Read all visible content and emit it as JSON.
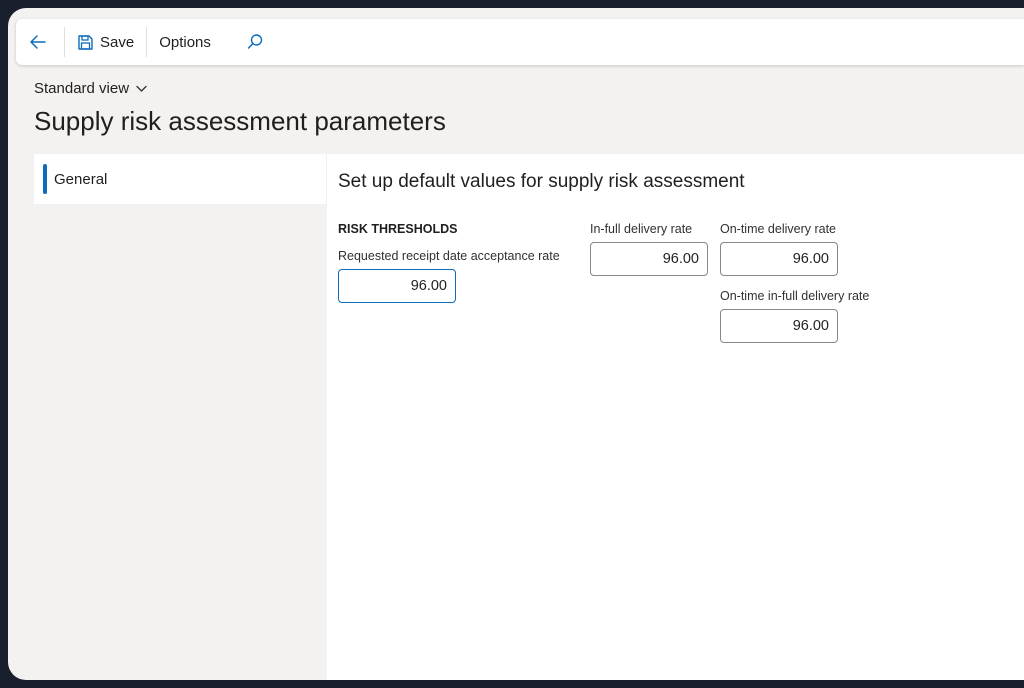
{
  "toolbar": {
    "back_icon": "arrow-left-icon",
    "save_label": "Save",
    "save_icon": "floppy-disk-icon",
    "options_label": "Options",
    "search_icon": "search-icon"
  },
  "view": {
    "label": "Standard view",
    "icon": "chevron-down-icon"
  },
  "page": {
    "title": "Supply risk assessment parameters"
  },
  "nav": {
    "items": [
      {
        "label": "General",
        "selected": true
      }
    ]
  },
  "main": {
    "section_title": "Set up default values for supply risk assessment",
    "group_header": "RISK THRESHOLDS",
    "fields": {
      "requested_receipt": {
        "label": "Requested receipt date acceptance rate",
        "value": "96.00"
      },
      "in_full": {
        "label": "In-full delivery rate",
        "value": "96.00"
      },
      "on_time": {
        "label": "On-time delivery rate",
        "value": "96.00"
      },
      "on_time_in_full": {
        "label": "On-time in-full delivery rate",
        "value": "96.00"
      }
    }
  },
  "colors": {
    "accent": "#0f6cbd",
    "background": "#f3f2f1",
    "frame": "#1a1f2e"
  }
}
